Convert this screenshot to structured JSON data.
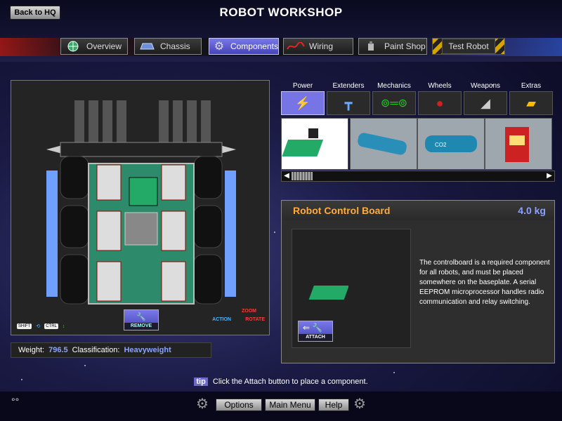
{
  "header": {
    "title": "ROBOT WORKSHOP",
    "back_label": "Back to HQ"
  },
  "nav": {
    "tabs": [
      {
        "label": "Overview",
        "icon": "globe-icon"
      },
      {
        "label": "Chassis",
        "icon": "chassis-icon"
      },
      {
        "label": "Components",
        "icon": "gear-icon",
        "active": true
      },
      {
        "label": "Wiring",
        "icon": "wire-icon"
      },
      {
        "label": "Paint Shop",
        "icon": "paint-icon"
      },
      {
        "label": "Test Robot",
        "icon": "hazard-icon"
      }
    ]
  },
  "viewport": {
    "legend_shift": "SHIFT",
    "legend_ctrl": "CTRL",
    "remove_label": "REMOVE",
    "zoom_label": "ZOOM",
    "rotate_label": "ROTATE",
    "action_label": "ACTION"
  },
  "status": {
    "weight_label": "Weight:",
    "weight_value": "796.5",
    "class_label": "Classification:",
    "class_value": "Heavyweight"
  },
  "categories": [
    {
      "label": "Power",
      "active": true
    },
    {
      "label": "Extenders"
    },
    {
      "label": "Mechanics"
    },
    {
      "label": "Wheels"
    },
    {
      "label": "Weapons"
    },
    {
      "label": "Extras"
    }
  ],
  "component": {
    "name": "Robot Control Board",
    "weight": "4.0 kg",
    "attach_label": "ATTACH",
    "description": "The controlboard is a required component for all robots, and must be placed somewhere on the baseplate. A serial EEPROM microprocessor handles radio communication and relay switching."
  },
  "tip": {
    "badge": "tip",
    "text": "Click the Attach button to place a component."
  },
  "bottom": {
    "options_label": "Options",
    "menu_label": "Main Menu",
    "help_label": "Help"
  },
  "colors": {
    "accent": "#7774e6",
    "name_color": "#ffab40",
    "value_color": "#8aa2ff"
  }
}
